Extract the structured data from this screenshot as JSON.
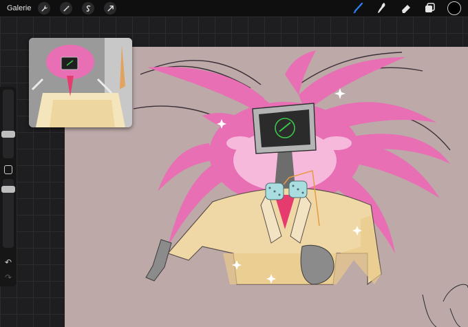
{
  "topbar": {
    "gallery_label": "Galerie"
  },
  "tools_left": [
    {
      "name": "actions",
      "icon": "wrench-icon"
    },
    {
      "name": "adjustments",
      "icon": "magic-wand-icon"
    },
    {
      "name": "selection",
      "icon": "selection-s-icon"
    },
    {
      "name": "transform",
      "icon": "arrow-cursor-icon"
    }
  ],
  "tools_right": [
    {
      "name": "brush",
      "icon": "brush-icon",
      "active": true
    },
    {
      "name": "smudge",
      "icon": "smudge-icon"
    },
    {
      "name": "eraser",
      "icon": "eraser-icon"
    },
    {
      "name": "layers",
      "icon": "layers-icon"
    }
  ],
  "colors": {
    "current_color": "#000000",
    "active_tool": "#2f7ff2",
    "canvas_bg": "#bca9a8",
    "feathers": "#e86fb4",
    "suit": "#efd8a6",
    "screen_glow": "#3cc84a"
  },
  "sidebar": {
    "brush_size_level": 0.28,
    "opacity_level": 0.72
  }
}
